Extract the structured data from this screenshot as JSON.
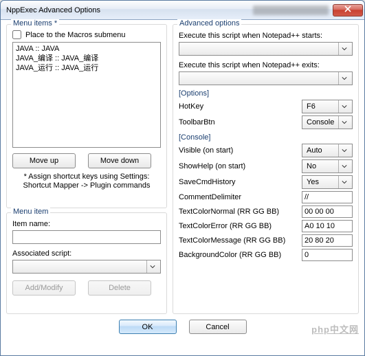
{
  "window": {
    "title": "NppExec Advanced Options"
  },
  "left": {
    "menu_group": "Menu items *",
    "place_macros": "Place to the Macros submenu",
    "items": [
      "JAVA :: JAVA",
      "JAVA_编译 :: JAVA_编译",
      "JAVA_运行 :: JAVA_运行"
    ],
    "move_up": "Move up",
    "move_down": "Move down",
    "hint1": "* Assign shortcut keys using Settings:",
    "hint2": "Shortcut Mapper -> Plugin commands",
    "item_group": "Menu item",
    "item_name_label": "Item name:",
    "item_name_value": "",
    "assoc_label": "Associated script:",
    "assoc_value": "",
    "add_modify": "Add/Modify",
    "delete": "Delete"
  },
  "right": {
    "adv_group": "Advanced options",
    "starts_label": "Execute this script when Notepad++ starts:",
    "starts_value": "",
    "exits_label": "Execute this script when Notepad++ exits:",
    "exits_value": "",
    "options_section": "[Options]",
    "hotkey_label": "HotKey",
    "hotkey_value": "F6",
    "toolbar_label": "ToolbarBtn",
    "toolbar_value": "Console",
    "console_section": "[Console]",
    "visible_label": "Visible (on start)",
    "visible_value": "Auto",
    "showhelp_label": "ShowHelp (on start)",
    "showhelp_value": "No",
    "savecmd_label": "SaveCmdHistory",
    "savecmd_value": "Yes",
    "cdelim_label": "CommentDelimiter",
    "cdelim_value": "//",
    "tcn_label": "TextColorNormal (RR GG BB)",
    "tcn_value": "00 00 00",
    "tce_label": "TextColorError (RR GG BB)",
    "tce_value": "A0 10 10",
    "tcm_label": "TextColorMessage (RR GG BB)",
    "tcm_value": "20 80 20",
    "bg_label": "BackgroundColor (RR GG BB)",
    "bg_value": "0"
  },
  "footer": {
    "ok": "OK",
    "cancel": "Cancel",
    "watermark": "php中文网"
  }
}
